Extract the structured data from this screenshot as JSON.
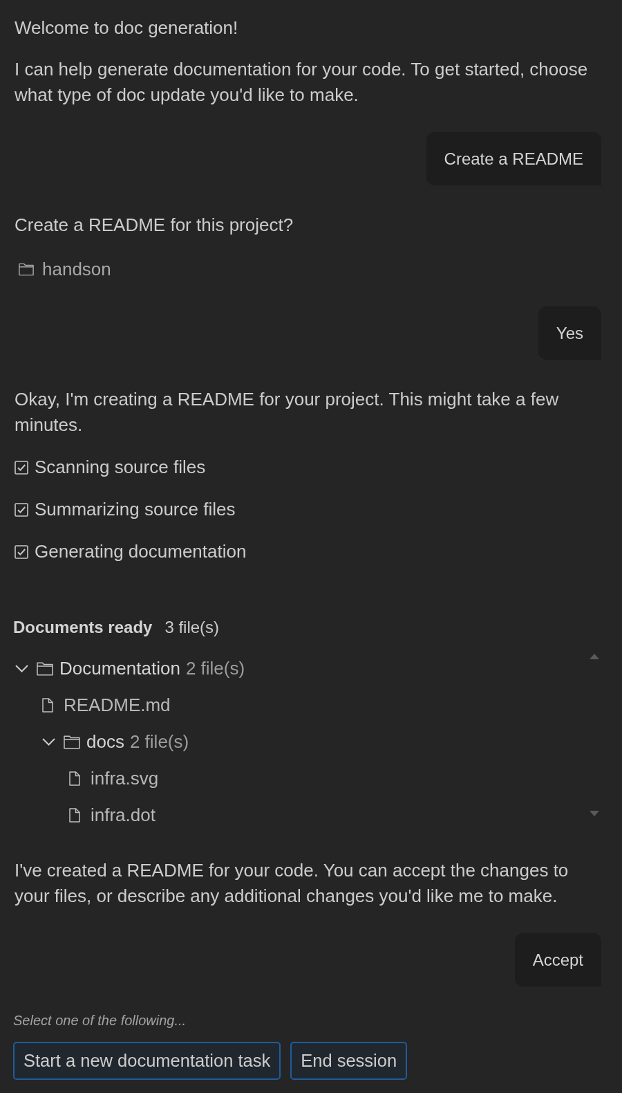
{
  "conversation": [
    {
      "kind": "text",
      "text": "Welcome to doc generation!"
    },
    {
      "kind": "text",
      "text": "I can help generate documentation for your code. To get started, choose what type of doc update you'd like to make."
    },
    {
      "kind": "user_message",
      "text": "Create a README"
    },
    {
      "kind": "text",
      "text": "Create a README for this project?"
    },
    {
      "kind": "folder",
      "label": "handson"
    },
    {
      "kind": "user_message",
      "text": "Yes"
    },
    {
      "kind": "text",
      "text": "Okay, I'm creating a README for your project. This might take a few minutes."
    },
    {
      "kind": "checklist",
      "items": [
        {
          "label": "Scanning source files",
          "checked": true
        },
        {
          "label": "Summarizing source files",
          "checked": true
        },
        {
          "label": "Generating documentation",
          "checked": true
        }
      ]
    },
    {
      "kind": "file_tree",
      "title": "Documents ready",
      "count": "3 file(s)",
      "items": [
        {
          "kind": "folder",
          "label": "Documentation",
          "count": "2 file(s)",
          "expanded": true,
          "children": [
            {
              "kind": "file",
              "label": "README.md"
            },
            {
              "kind": "folder",
              "label": "docs",
              "count": "2 file(s)",
              "expanded": true,
              "children": [
                {
                  "kind": "file",
                  "label": "infra.svg"
                },
                {
                  "kind": "file",
                  "label": "infra.dot"
                }
              ]
            }
          ]
        }
      ]
    },
    {
      "kind": "text",
      "text": "I've created a README for your code. You can accept the changes to your files, or describe any additional changes you'd like me to make."
    },
    {
      "kind": "user_message",
      "text": "Accept"
    },
    {
      "kind": "prompt",
      "text": "Select one of the following..."
    },
    {
      "kind": "actions",
      "buttons": [
        {
          "label": "Start a new documentation task"
        },
        {
          "label": "End session"
        }
      ]
    }
  ]
}
